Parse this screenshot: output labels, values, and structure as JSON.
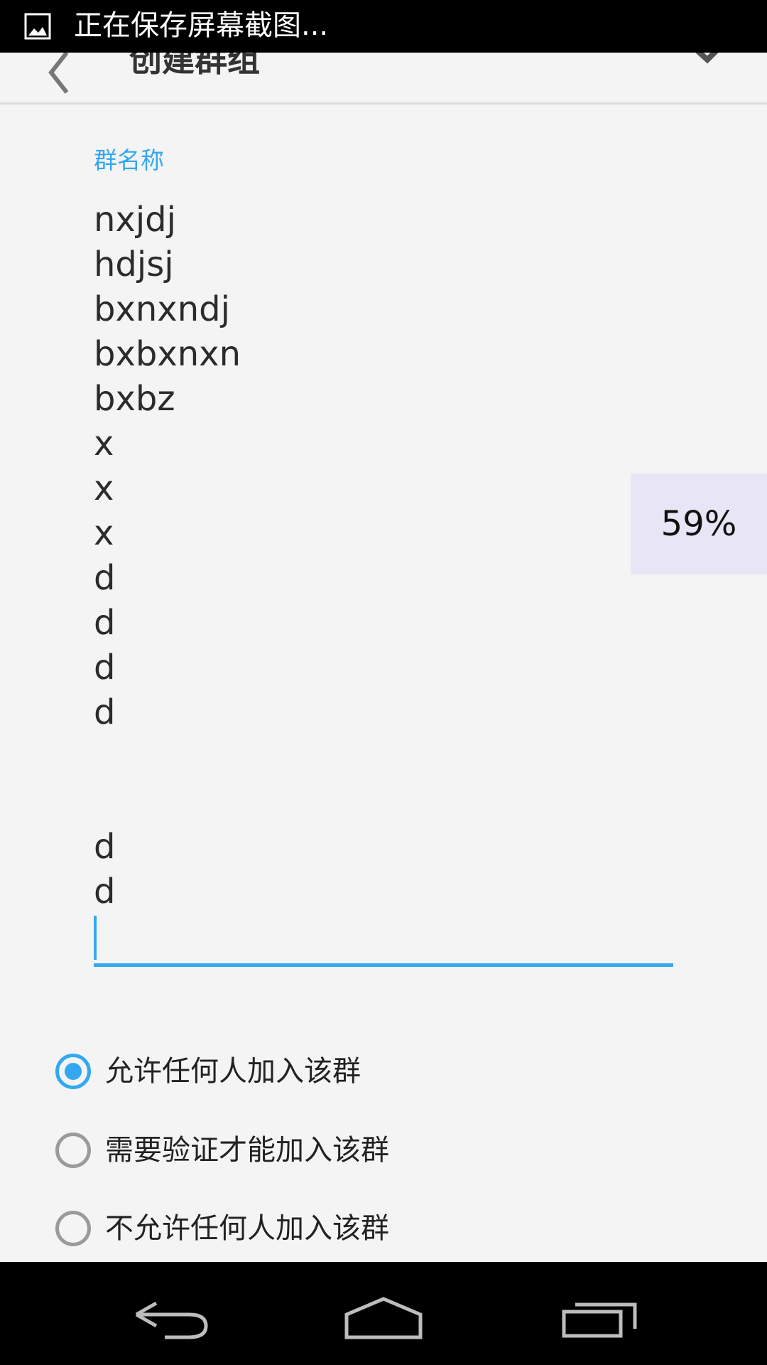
{
  "status_bar": {
    "icon": "image-icon",
    "text": "正在保存屏幕截图..."
  },
  "action_bar": {
    "back_icon": "chevron-left-icon",
    "title": "创建群组",
    "done_icon": "checkmark-icon"
  },
  "form": {
    "field_label": "群名称",
    "group_name_value": "nxjdj\nhdjsj\nbxnxndj\nbxbxnxn\nbxbz\nx\nx\nx\nd\nd\nd\nd\n\n\nd\nd",
    "accent_color": "#33a8f0"
  },
  "scroll_indicator": {
    "label": "59%"
  },
  "join_options": [
    {
      "label": "允许任何人加入该群",
      "selected": true
    },
    {
      "label": "需要验证才能加入该群",
      "selected": false
    },
    {
      "label": "不允许任何人加入该群",
      "selected": false
    }
  ],
  "nav_bar": {
    "back": "nav-back-icon",
    "home": "nav-home-icon",
    "recents": "nav-recents-icon"
  }
}
